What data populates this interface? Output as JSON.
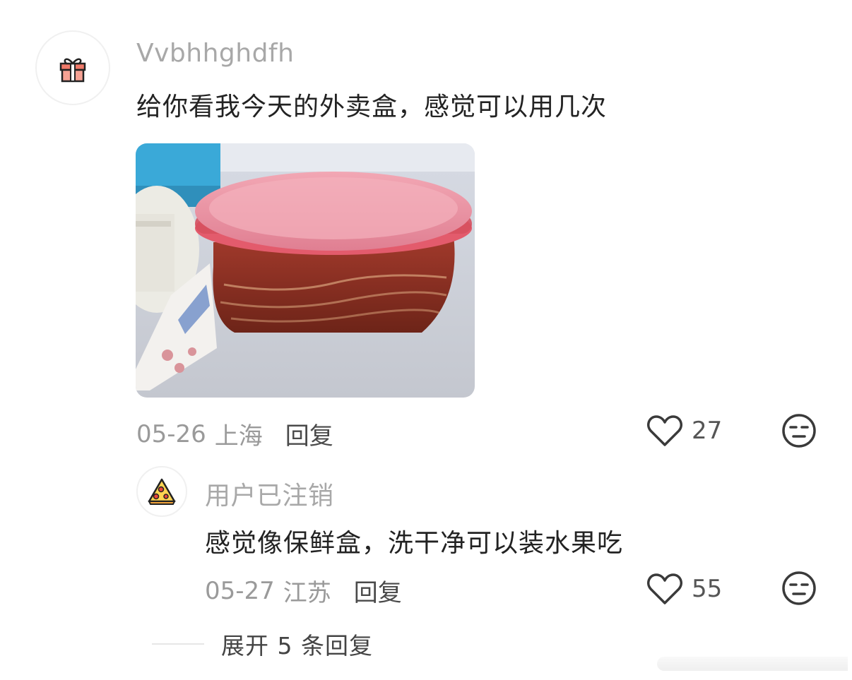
{
  "comment": {
    "username": "Vvbhhghdfh",
    "avatar_icon": "gift-icon",
    "text": "给你看我今天的外卖盒，感觉可以用几次",
    "image_icon": "takeout-box-photo",
    "date": "05-26",
    "location": "上海",
    "reply_label": "回复",
    "likes": "27"
  },
  "reply": {
    "username": "用户已注销",
    "avatar_icon": "pizza-icon",
    "text": "感觉像保鲜盒，洗干净可以装水果吃",
    "date": "05-27",
    "location": "江苏",
    "reply_label": "回复",
    "likes": "55"
  },
  "expand": {
    "label": "展开 5 条回复"
  },
  "colors": {
    "username": "#a8a8a8",
    "meta": "#9a9a9a",
    "lid": "#e98fa0",
    "noodle": "#8a2a1e"
  }
}
